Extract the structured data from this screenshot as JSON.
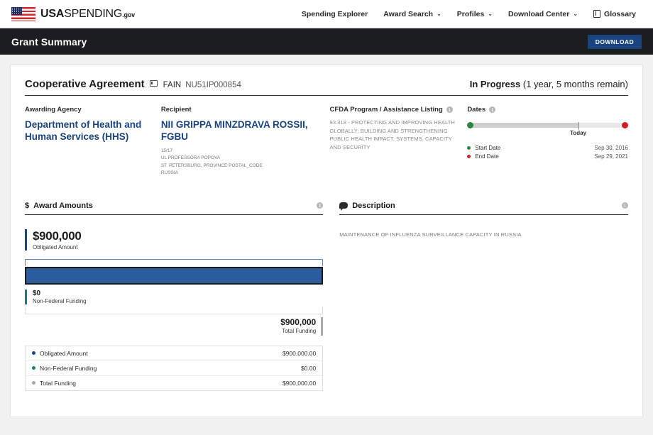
{
  "topnav": {
    "brand": {
      "bold": "USA",
      "normal": "SPENDING",
      "suffix": ".gov"
    },
    "links": [
      {
        "label": "Spending Explorer",
        "caret": false,
        "icon": null
      },
      {
        "label": "Award Search",
        "caret": true,
        "icon": null
      },
      {
        "label": "Profiles",
        "caret": true,
        "icon": null
      },
      {
        "label": "Download Center",
        "caret": true,
        "icon": null
      },
      {
        "label": "Glossary",
        "caret": false,
        "icon": "book-icon"
      }
    ],
    "caret_glyph": "⌄"
  },
  "banner": {
    "title": "Grant Summary",
    "download_label": "DOWNLOAD"
  },
  "award": {
    "type": "Cooperative Agreement",
    "fain_label": "FAIN",
    "fain_value": "NU51IP000854",
    "status_bold": "In Progress",
    "status_detail": "(1 year, 5 months remain)"
  },
  "overview": {
    "agency": {
      "label": "Awarding Agency",
      "name": "Department of Health and Human Services (HHS)"
    },
    "recipient": {
      "label": "Recipient",
      "name": "NII GRIPPA MINZDRAVA ROSSII, FGBU",
      "address": [
        "15/17",
        "UL PROFESSORA POPOVA",
        "ST. PETERSBURG, PROVINCE POSTAL_CODE",
        "RUSSIA"
      ]
    },
    "cfda": {
      "label": "CFDA Program / Assistance Listing",
      "text": "93.318 - PROTECTING AND IMPROVING HEALTH GLOBALLY: BUILDING AND STRENGTHENING PUBLIC HEALTH IMPACT, SYSTEMS, CAPACITY AND SECURITY"
    },
    "dates": {
      "label": "Dates",
      "today_label": "Today",
      "progress_percent": 70,
      "rows": [
        {
          "label": "Start Date",
          "value": "Sep 30, 2016",
          "color": "green"
        },
        {
          "label": "End Date",
          "value": "Sep 29, 2021",
          "color": "red"
        }
      ]
    }
  },
  "award_amounts": {
    "panel_title": "Award Amounts",
    "dollar_glyph": "$",
    "obligated": {
      "amount": "$900,000",
      "label": "Obligated Amount"
    },
    "non_federal": {
      "amount": "$0",
      "label": "Non-Federal Funding"
    },
    "total": {
      "amount": "$900,000",
      "label": "Total Funding"
    },
    "legend": [
      {
        "label": "Obligated Amount",
        "value": "$900,000.00",
        "color": "navy"
      },
      {
        "label": "Non-Federal Funding",
        "value": "$0.00",
        "color": "teal"
      },
      {
        "label": "Total Funding",
        "value": "$900,000.00",
        "color": "gray"
      }
    ]
  },
  "description": {
    "panel_title": "Description",
    "text": "MAINTENANCE OF INFLUENZA SURVEILLANCE CAPACITY IN RUSSIA"
  },
  "colors": {
    "accent_navy": "#1a4480",
    "bar_blue": "#2b5c9b",
    "teal": "#0f8075",
    "green": "#2e8540",
    "red": "#cd2026",
    "banner_black": "#1c1d1f"
  },
  "info_glyph": "i"
}
